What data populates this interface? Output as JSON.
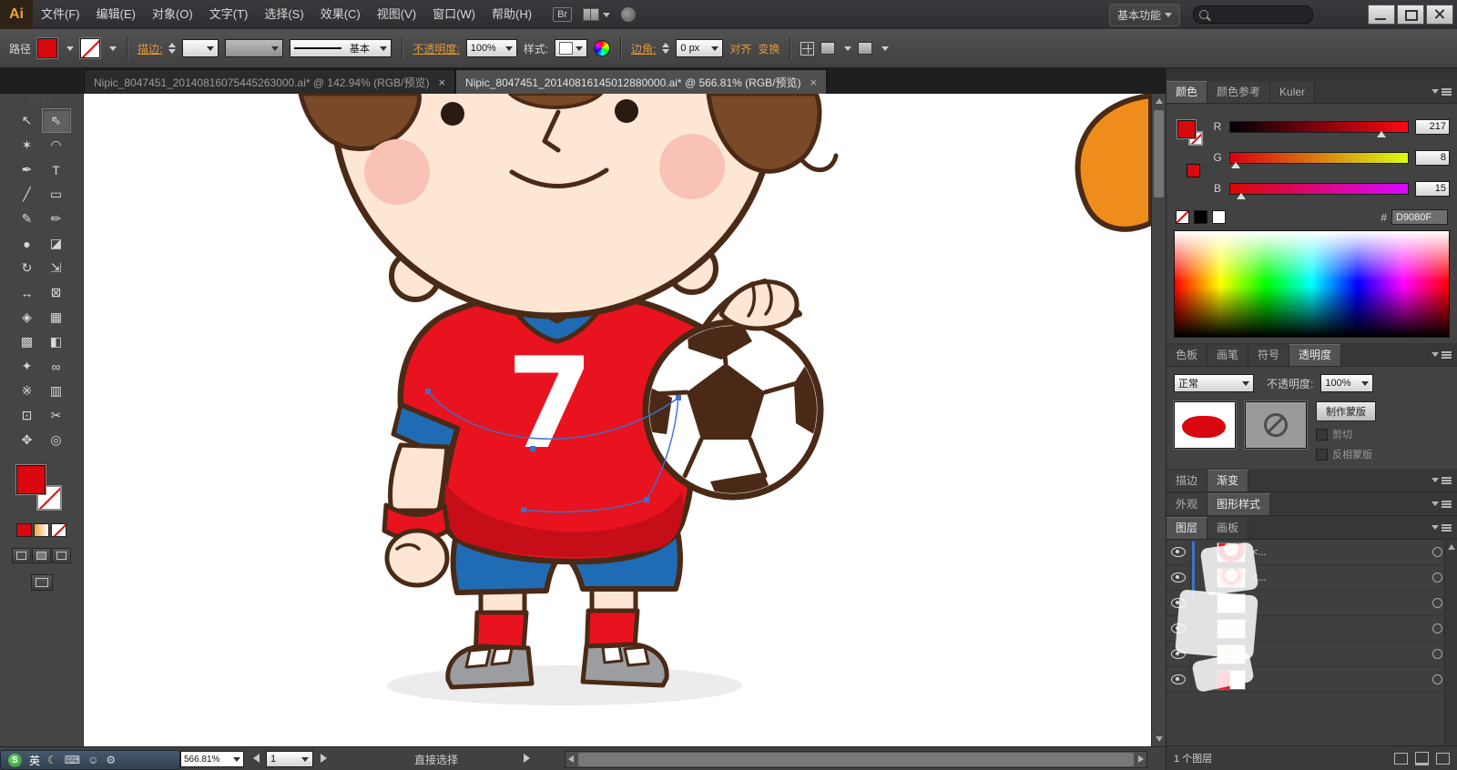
{
  "window": {
    "logo": "Ai",
    "menus": [
      "文件(F)",
      "编辑(E)",
      "对象(O)",
      "文字(T)",
      "选择(S)",
      "效果(C)",
      "视图(V)",
      "窗口(W)",
      "帮助(H)"
    ],
    "bridge_label": "Br",
    "workspace_label": "基本功能",
    "search_value": ""
  },
  "control": {
    "context_label": "路径",
    "stroke_label": "描边:",
    "brush_label": "基本",
    "opacity_label": "不透明度:",
    "opacity_value": "100%",
    "style_label": "样式:",
    "corner_label": "边角:",
    "corner_value": "0 px",
    "align_label": "对齐",
    "transform_label": "变换"
  },
  "doc_tabs": [
    {
      "title": "Nipic_8047451_20140816075445263000.ai* @ 142.94% (RGB/预览)",
      "close_label": "×"
    },
    {
      "title": "Nipic_8047451_20140816145012880000.ai* @ 566.81% (RGB/预览)",
      "close_label": "×"
    }
  ],
  "tools": [
    {
      "name": "selection",
      "glyph": "↖"
    },
    {
      "name": "direct-selection",
      "glyph": "⇖"
    },
    {
      "name": "magic-wand",
      "glyph": "✶"
    },
    {
      "name": "lasso",
      "glyph": "◠"
    },
    {
      "name": "pen",
      "glyph": "✒"
    },
    {
      "name": "type",
      "glyph": "T"
    },
    {
      "name": "line-segment",
      "glyph": "╱"
    },
    {
      "name": "rectangle",
      "glyph": "▭"
    },
    {
      "name": "paintbrush",
      "glyph": "✎"
    },
    {
      "name": "pencil",
      "glyph": "✏"
    },
    {
      "name": "blob-brush",
      "glyph": "●"
    },
    {
      "name": "eraser",
      "glyph": "◪"
    },
    {
      "name": "rotate",
      "glyph": "↻"
    },
    {
      "name": "scale",
      "glyph": "⇲"
    },
    {
      "name": "width",
      "glyph": "↔"
    },
    {
      "name": "free-transform",
      "glyph": "⊠"
    },
    {
      "name": "shape-builder",
      "glyph": "◈"
    },
    {
      "name": "perspective-grid",
      "glyph": "▦"
    },
    {
      "name": "mesh",
      "glyph": "▩"
    },
    {
      "name": "gradient",
      "glyph": "◧"
    },
    {
      "name": "eyedropper",
      "glyph": "✦"
    },
    {
      "name": "blend",
      "glyph": "∞"
    },
    {
      "name": "symbol-sprayer",
      "glyph": "※"
    },
    {
      "name": "column-graph",
      "glyph": "▥"
    },
    {
      "name": "artboard",
      "glyph": "⊡"
    },
    {
      "name": "slice",
      "glyph": "✂"
    },
    {
      "name": "hand",
      "glyph": "✥"
    },
    {
      "name": "zoom",
      "glyph": "◎"
    }
  ],
  "canvas": {
    "jersey_number": "7"
  },
  "color_panel": {
    "tabs": [
      "颜色",
      "颜色参考",
      "Kuler"
    ],
    "channels": [
      {
        "label": "R",
        "value": "217"
      },
      {
        "label": "G",
        "value": "8"
      },
      {
        "label": "B",
        "value": "15"
      }
    ],
    "hex_prefix": "#",
    "hex_value": "D9080F"
  },
  "middle_tabs": [
    "色板",
    "画笔",
    "符号",
    "透明度"
  ],
  "transparency": {
    "blend_mode": "正常",
    "opacity_label": "不透明度:",
    "opacity_value": "100%",
    "make_mask_label": "制作蒙版",
    "clip_label": "剪切",
    "invert_label": "反相蒙版"
  },
  "stroke_gradient_tabs": [
    "描边",
    "渐变"
  ],
  "appearance_tabs": [
    "外观",
    "图形样式"
  ],
  "layers": {
    "tabs": [
      "图层",
      "画板"
    ],
    "rows": [
      {
        "name": "<..."
      },
      {
        "name": "<..."
      },
      {
        "name": ""
      },
      {
        "name": ""
      },
      {
        "name": ""
      },
      {
        "name": ""
      }
    ],
    "footer": "1 个图层"
  },
  "statusbar": {
    "zoom": "566.81%",
    "artboard": "1",
    "tool": "直接选择"
  },
  "ime": {
    "logo": "S",
    "lang": "英",
    "icons": [
      "☾",
      "⌨",
      "☺",
      "⚙"
    ]
  },
  "colors": {
    "fill_red": "#D9080F",
    "accent_orange": "#E09A3A",
    "jersey_blue": "#1F6CB4",
    "jersey_red": "#E8131F"
  }
}
